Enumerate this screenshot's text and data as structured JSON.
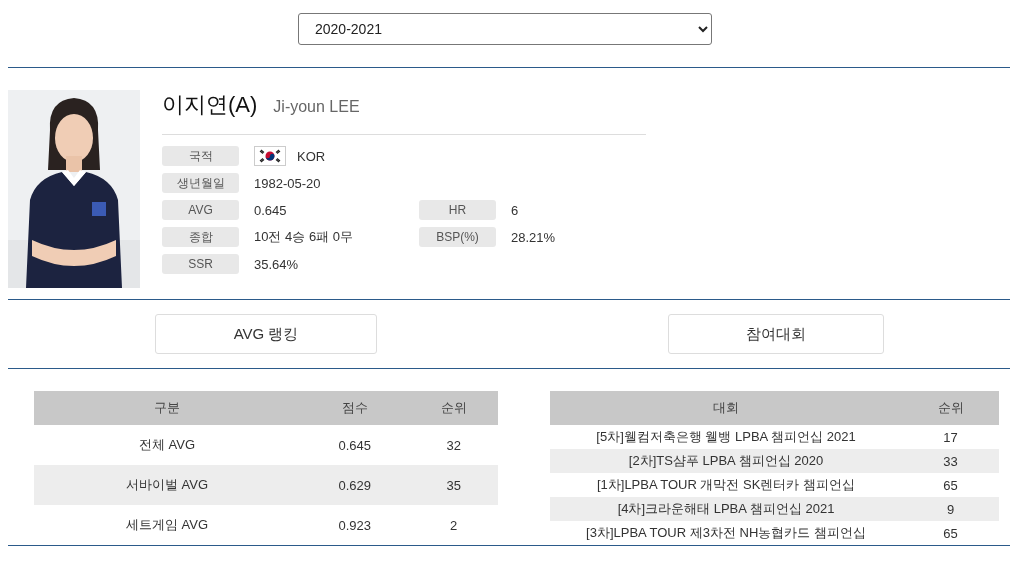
{
  "season_select": {
    "value": "2020-2021"
  },
  "player": {
    "name": "이지연(A)",
    "name_en": "Ji-youn LEE",
    "info": [
      {
        "label": "국적",
        "value": "KOR",
        "kind": "flag"
      },
      {
        "label": "생년월일",
        "value": "1982-05-20",
        "kind": "text"
      },
      {
        "label": "AVG",
        "value": "0.645",
        "kind": "text",
        "label2": "HR",
        "value2": "6"
      },
      {
        "label": "종합",
        "value": "10전 4승 6패 0무",
        "kind": "text",
        "label2": "BSP(%)",
        "value2": "28.21%"
      },
      {
        "label": "SSR",
        "value": "35.64%",
        "kind": "text"
      }
    ]
  },
  "section_buttons": [
    "AVG 랭킹",
    "참여대회"
  ],
  "avg_table": {
    "columns": [
      "구분",
      "점수",
      "순위"
    ],
    "rows": [
      [
        "전체 AVG",
        "0.645",
        "32"
      ],
      [
        "서바이벌 AVG",
        "0.629",
        "35"
      ],
      [
        "세트게임 AVG",
        "0.923",
        "2"
      ]
    ]
  },
  "tournament_table": {
    "columns": [
      "대회",
      "순위"
    ],
    "rows": [
      [
        "[5차]웰컴저축은행 웰뱅 LPBA 챔피언십 2021",
        "17"
      ],
      [
        "[2차]TS샴푸 LPBA 챔피언십 2020",
        "33"
      ],
      [
        "[1차]LPBA TOUR 개막전 SK렌터카 챔피언십",
        "65"
      ],
      [
        "[4차]크라운해태 LPBA 챔피언십 2021",
        "9"
      ],
      [
        "[3차]LPBA TOUR 제3차전 NH농협카드 챔피언십",
        "65"
      ]
    ]
  }
}
